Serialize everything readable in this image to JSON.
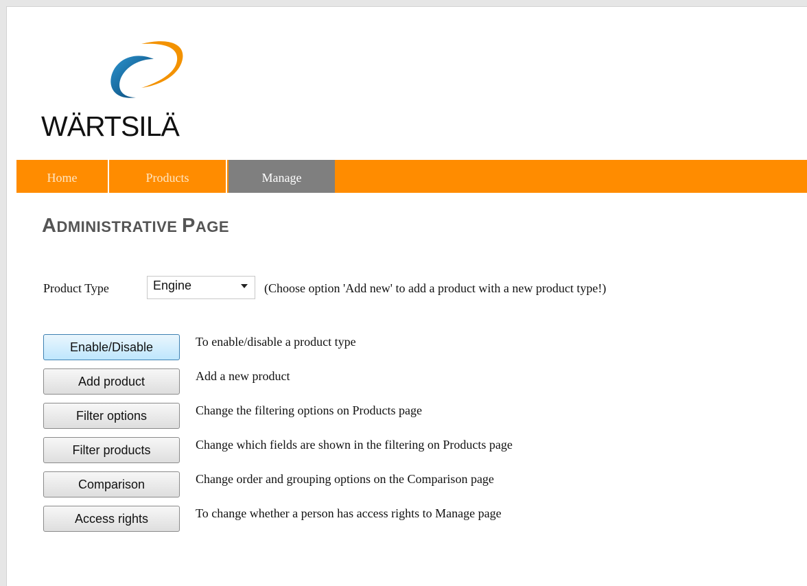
{
  "logo": {
    "text": "WÄRTSILÄ",
    "colors": {
      "blue": "#0a6ea8",
      "orange": "#f39200"
    }
  },
  "nav": {
    "tabs": [
      {
        "label": "Home",
        "active": false
      },
      {
        "label": "Products",
        "active": false
      },
      {
        "label": "Manage",
        "active": true
      }
    ],
    "bar_color": "#ff8c00",
    "active_color": "#7f7f7f"
  },
  "page": {
    "title_first": "A",
    "title_rest": "DMINISTRATIVE ",
    "title_second_first": "P",
    "title_second_rest": "AGE"
  },
  "product_type": {
    "label": "Product Type",
    "selected": "Engine",
    "hint": "(Choose option 'Add new' to add a product with a new product type!)"
  },
  "actions": [
    {
      "button": "Enable/Disable",
      "description": "To enable/disable a product type",
      "focused": true
    },
    {
      "button": "Add product",
      "description": "Add a new product",
      "focused": false
    },
    {
      "button": "Filter options",
      "description": "Change the filtering options on Products page",
      "focused": false
    },
    {
      "button": "Filter products",
      "description": "Change which fields are shown in the filtering on Products page",
      "focused": false
    },
    {
      "button": "Comparison",
      "description": "Change order and grouping options on the Comparison page",
      "focused": false
    },
    {
      "button": "Access rights",
      "description": "To change whether a person has access rights to Manage page",
      "focused": false
    }
  ]
}
